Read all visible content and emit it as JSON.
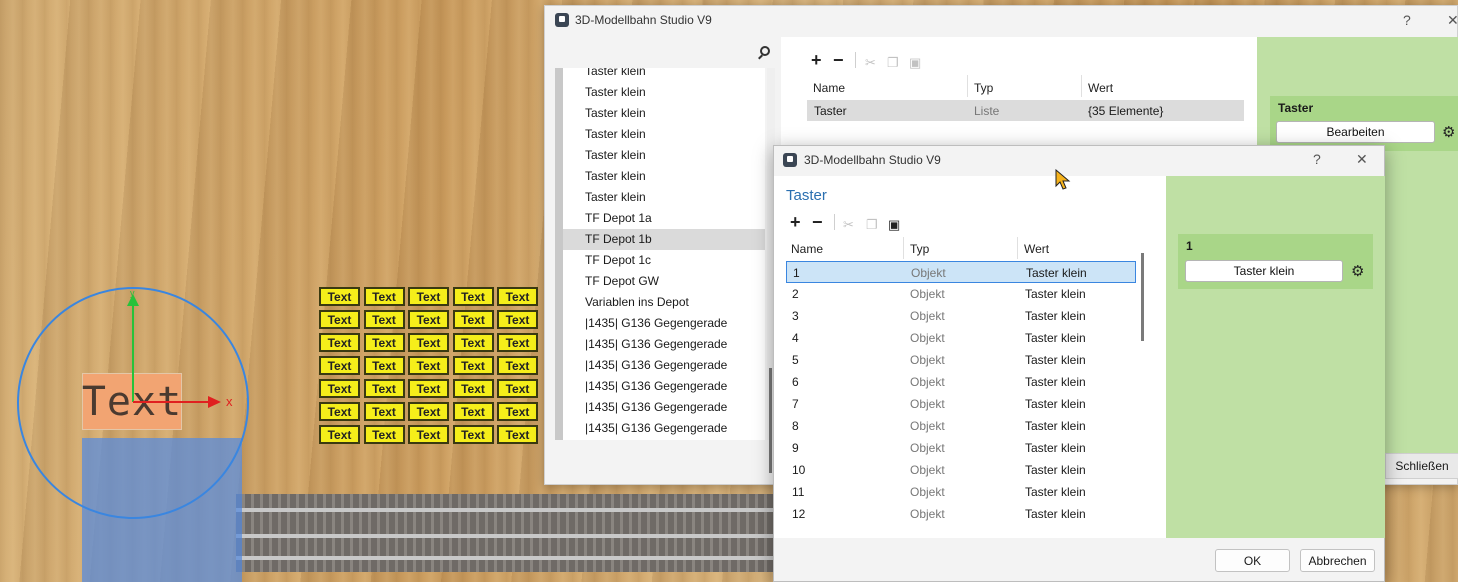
{
  "scene": {
    "sign_text": "Text",
    "axis_x_label": "x",
    "axis_y_label": "y",
    "tile_label": "Text"
  },
  "back_window": {
    "title": "3D-Modellbahn Studio V9",
    "help": "?",
    "close": "✕",
    "list_items": [
      "Taster klein",
      "Taster klein",
      "Taster klein",
      "Taster klein",
      "Taster klein",
      "Taster klein",
      "Taster klein",
      "TF Depot 1a",
      "TF Depot 1b",
      "TF Depot 1c",
      "TF Depot GW",
      "Variablen ins Depot",
      "|1435| G136 Gegengerade",
      "|1435| G136 Gegengerade",
      "|1435| G136 Gegengerade",
      "|1435| G136 Gegengerade",
      "|1435| G136 Gegengerade",
      "|1435| G136 Gegengerade"
    ],
    "grid_headers": {
      "name": "Name",
      "type": "Typ",
      "value": "Wert"
    },
    "grid_row": {
      "name": "Taster",
      "type": "Liste",
      "value": "{35 Elemente}"
    },
    "prop_title": "Taster",
    "edit_button": "Bearbeiten",
    "close_button": "Schließen"
  },
  "dialog": {
    "title": "3D-Modellbahn Studio V9",
    "help": "?",
    "close": "✕",
    "heading": "Taster",
    "headers": {
      "name": "Name",
      "type": "Typ",
      "value": "Wert"
    },
    "rows": [
      {
        "name": "1",
        "type": "Objekt",
        "value": "Taster klein"
      },
      {
        "name": "2",
        "type": "Objekt",
        "value": "Taster klein"
      },
      {
        "name": "3",
        "type": "Objekt",
        "value": "Taster klein"
      },
      {
        "name": "4",
        "type": "Objekt",
        "value": "Taster klein"
      },
      {
        "name": "5",
        "type": "Objekt",
        "value": "Taster klein"
      },
      {
        "name": "6",
        "type": "Objekt",
        "value": "Taster klein"
      },
      {
        "name": "7",
        "type": "Objekt",
        "value": "Taster klein"
      },
      {
        "name": "8",
        "type": "Objekt",
        "value": "Taster klein"
      },
      {
        "name": "9",
        "type": "Objekt",
        "value": "Taster klein"
      },
      {
        "name": "10",
        "type": "Objekt",
        "value": "Taster klein"
      },
      {
        "name": "11",
        "type": "Objekt",
        "value": "Taster klein"
      },
      {
        "name": "12",
        "type": "Objekt",
        "value": "Taster klein"
      }
    ],
    "prop_title": "1",
    "prop_button": "Taster klein",
    "ok": "OK",
    "cancel": "Abbrechen"
  },
  "colors": {
    "accent": "#2a6fb0",
    "selection": "#cce4f7",
    "panel_green": "#bfe0a4"
  }
}
